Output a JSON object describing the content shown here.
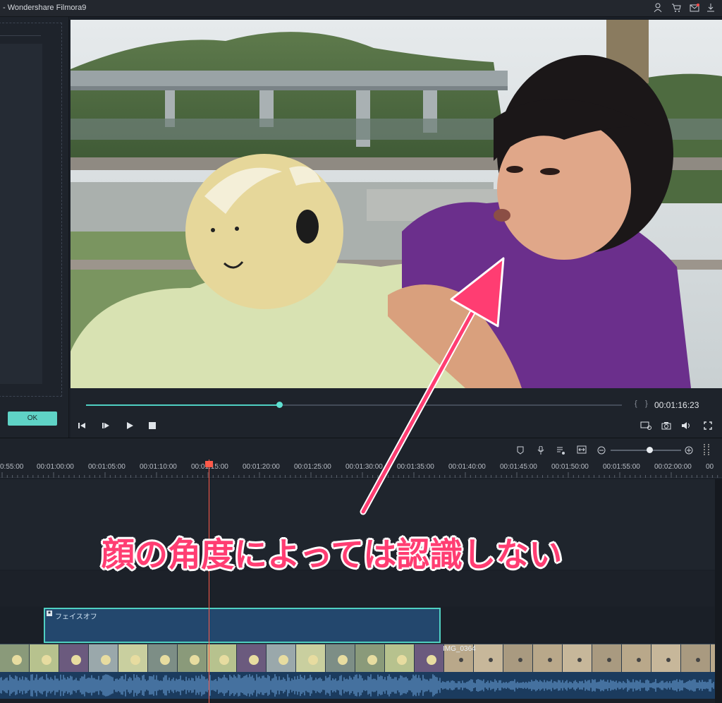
{
  "window": {
    "title": "- Wondershare Filmora9"
  },
  "titlebar_icons": [
    "account-icon",
    "cart-icon",
    "mail-icon",
    "download-icon"
  ],
  "left_panel": {
    "ok_label": "OK"
  },
  "player": {
    "timecode": "00:01:16:23",
    "progress": 0.36,
    "controls": [
      "prev-frame-icon",
      "next-frame-icon",
      "play-icon",
      "stop-icon"
    ],
    "right_controls": [
      "display-settings-icon",
      "snapshot-icon",
      "volume-icon",
      "fullscreen-icon"
    ],
    "mark_in": "{",
    "mark_out": "}"
  },
  "timeline": {
    "toolbar_icons": [
      "marker-icon",
      "mic-icon",
      "voiceover-icon",
      "fit-icon",
      "zoom-out-icon",
      "zoom-in-icon"
    ],
    "zoom_level": 0.6,
    "ruler": [
      "0:55:00",
      "00:01:00:00",
      "00:01:05:00",
      "00:01:10:00",
      "00:01:15:00",
      "00:01:20:00",
      "00:01:25:00",
      "00:01:30:00",
      "00:01:35:00",
      "00:01:40:00",
      "00:01:45:00",
      "00:01:50:00",
      "00:01:55:00",
      "00:02:00:00",
      "00"
    ],
    "effect_clip_label": "フェイスオフ",
    "next_clip_label": "IMG_0364"
  },
  "annotation": {
    "text": "顔の角度によっては認識しない",
    "color": "#ff3d72"
  },
  "colors": {
    "accent": "#4fd0c2",
    "playhead": "#ff5a4a",
    "clip": "#23476d"
  }
}
